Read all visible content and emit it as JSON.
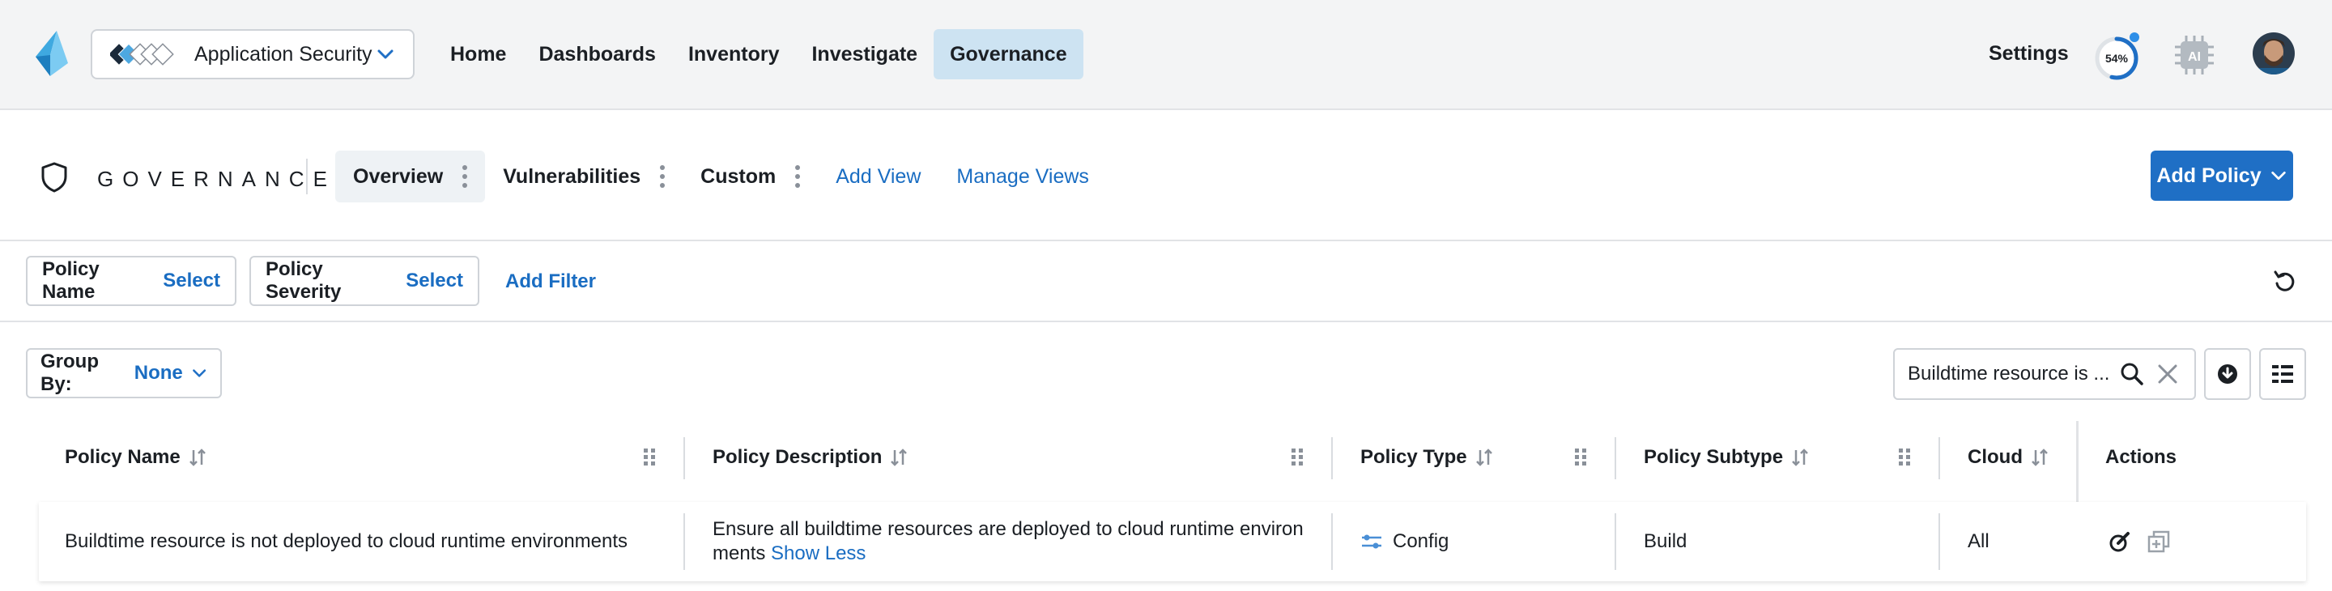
{
  "topbar": {
    "app_switcher_label": "Application Security",
    "nav": [
      "Home",
      "Dashboards",
      "Inventory",
      "Investigate",
      "Governance"
    ],
    "active_nav": "Governance",
    "settings_label": "Settings",
    "progress_text": "54%",
    "progress_value": 0.54,
    "ai_label": "AI"
  },
  "governance": {
    "title": "GOVERNANCE",
    "views": [
      "Overview",
      "Vulnerabilities",
      "Custom"
    ],
    "active_view": "Overview",
    "add_view_label": "Add View",
    "manage_views_label": "Manage Views",
    "add_policy_label": "Add Policy"
  },
  "filters": {
    "items": [
      {
        "name": "Policy Name",
        "value": "Select"
      },
      {
        "name": "Policy Severity",
        "value": "Select"
      }
    ],
    "add_filter_label": "Add Filter"
  },
  "toolbar": {
    "group_by_label": "Group By:",
    "group_by_value": "None",
    "search_value": "Buildtime resource is ..."
  },
  "table": {
    "columns": [
      "Policy Name",
      "Policy Description",
      "Policy Type",
      "Policy Subtype",
      "Cloud",
      "Actions"
    ],
    "rows": [
      {
        "policy_name": "Buildtime resource is not deployed to cloud runtime environments",
        "description_line1": "Ensure all buildtime resources are deployed to cloud runtime environ",
        "description_line2": "ments",
        "show_less": "Show Less",
        "policy_type": "Config",
        "policy_subtype": "Build",
        "cloud": "All"
      }
    ]
  },
  "colors": {
    "accent": "#1f6fc5",
    "link": "#1a6dc2",
    "nav_active_bg": "#cde3f2",
    "topbar_bg": "#f3f4f5"
  }
}
